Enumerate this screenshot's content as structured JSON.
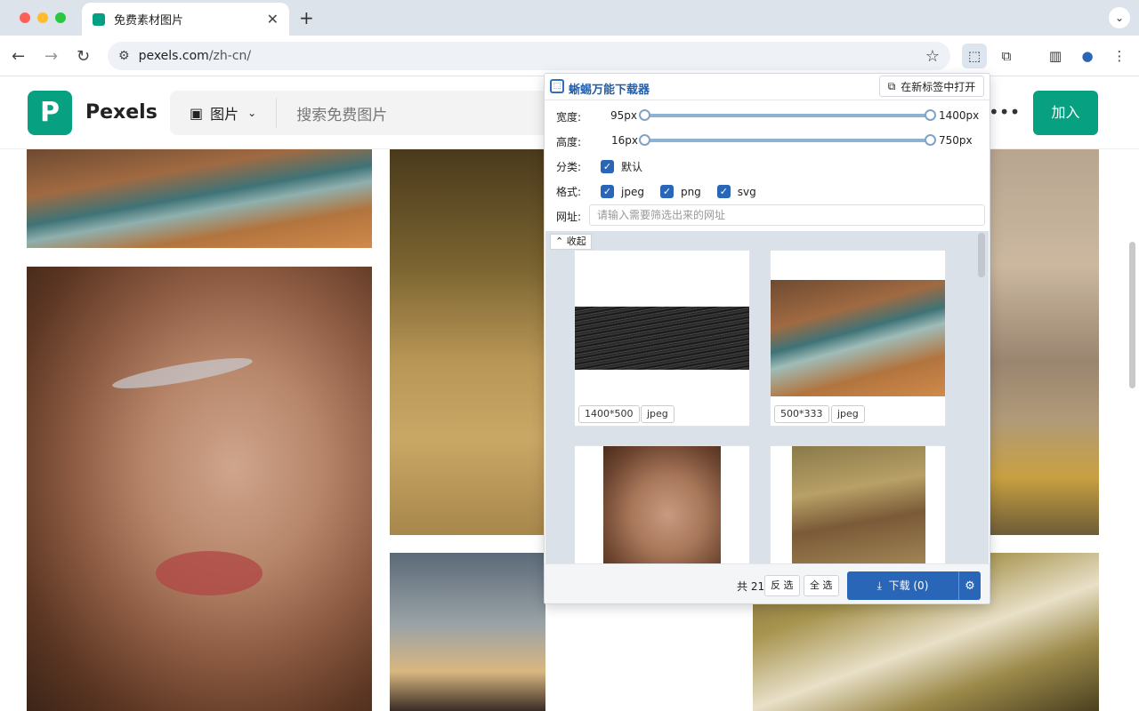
{
  "browser": {
    "tab_title": "免费素材图片",
    "url_host": "pexels.com",
    "url_path": "/zh-cn/",
    "colors": {
      "tab_strip": "#dde3ea",
      "close_dot": "#fe5f57",
      "min_dot": "#febc2e",
      "max_dot": "#28c840"
    }
  },
  "site": {
    "logo_letter": "P",
    "brand": "Pexels",
    "search_type": "图片",
    "search_placeholder": "搜索免费图片",
    "join_label": "加入",
    "accent": "#07a081"
  },
  "panel": {
    "title": "蜥蜴万能下载器",
    "open_new_tab": "在新标签中打开",
    "width_label": "宽度:",
    "width_min": "95px",
    "width_max": "1400px",
    "height_label": "高度:",
    "height_min": "16px",
    "height_max": "750px",
    "category_label": "分类:",
    "category_default": "默认",
    "format_label": "格式:",
    "formats": [
      "jpeg",
      "png",
      "svg"
    ],
    "url_label": "网址:",
    "url_placeholder": "请输入需要筛选出来的网址",
    "collapse_label": "收起",
    "cards": [
      {
        "size": "1400*500",
        "format": "jpeg"
      },
      {
        "size": "500*333",
        "format": "jpeg"
      }
    ],
    "total": "共 21",
    "invert_label": "反 选",
    "select_all_label": "全 选",
    "download_label": "下载 (0)",
    "accent": "#2a66b8"
  }
}
